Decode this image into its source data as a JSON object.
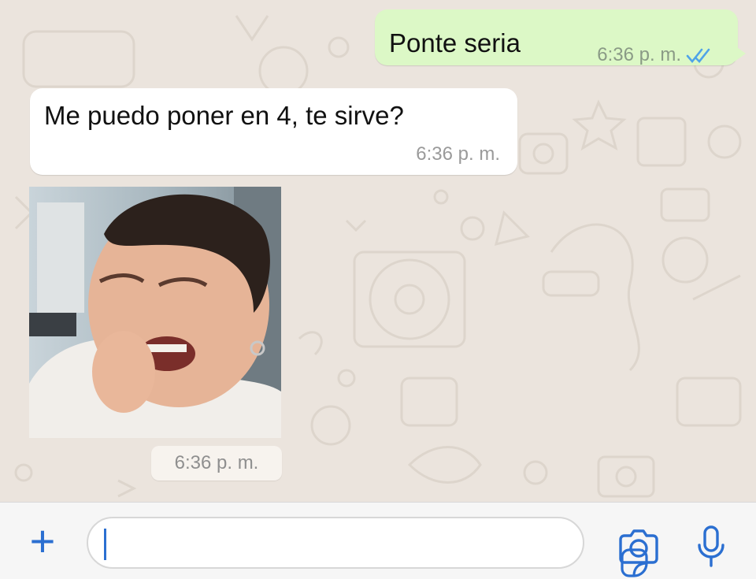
{
  "conversation": {
    "messages": [
      {
        "direction": "outgoing",
        "text": "Ponte seria",
        "time": "6:36 p. m.",
        "status": "read"
      },
      {
        "direction": "incoming",
        "text": "Me puedo poner en 4, te sirve?",
        "time": "6:36 p. m."
      },
      {
        "direction": "incoming",
        "type": "image",
        "time": "6:36 p. m."
      }
    ]
  },
  "composer": {
    "value": "",
    "placeholder": ""
  },
  "icons": {
    "attach": "plus-icon",
    "sticker": "sticker-icon",
    "camera": "camera-icon",
    "mic": "microphone-icon",
    "read_receipt": "double-check-icon"
  },
  "colors": {
    "outgoing_bubble": "#dcf8c6",
    "incoming_bubble": "#ffffff",
    "accent": "#2b6fd1",
    "chat_background": "#ebe4dd"
  }
}
